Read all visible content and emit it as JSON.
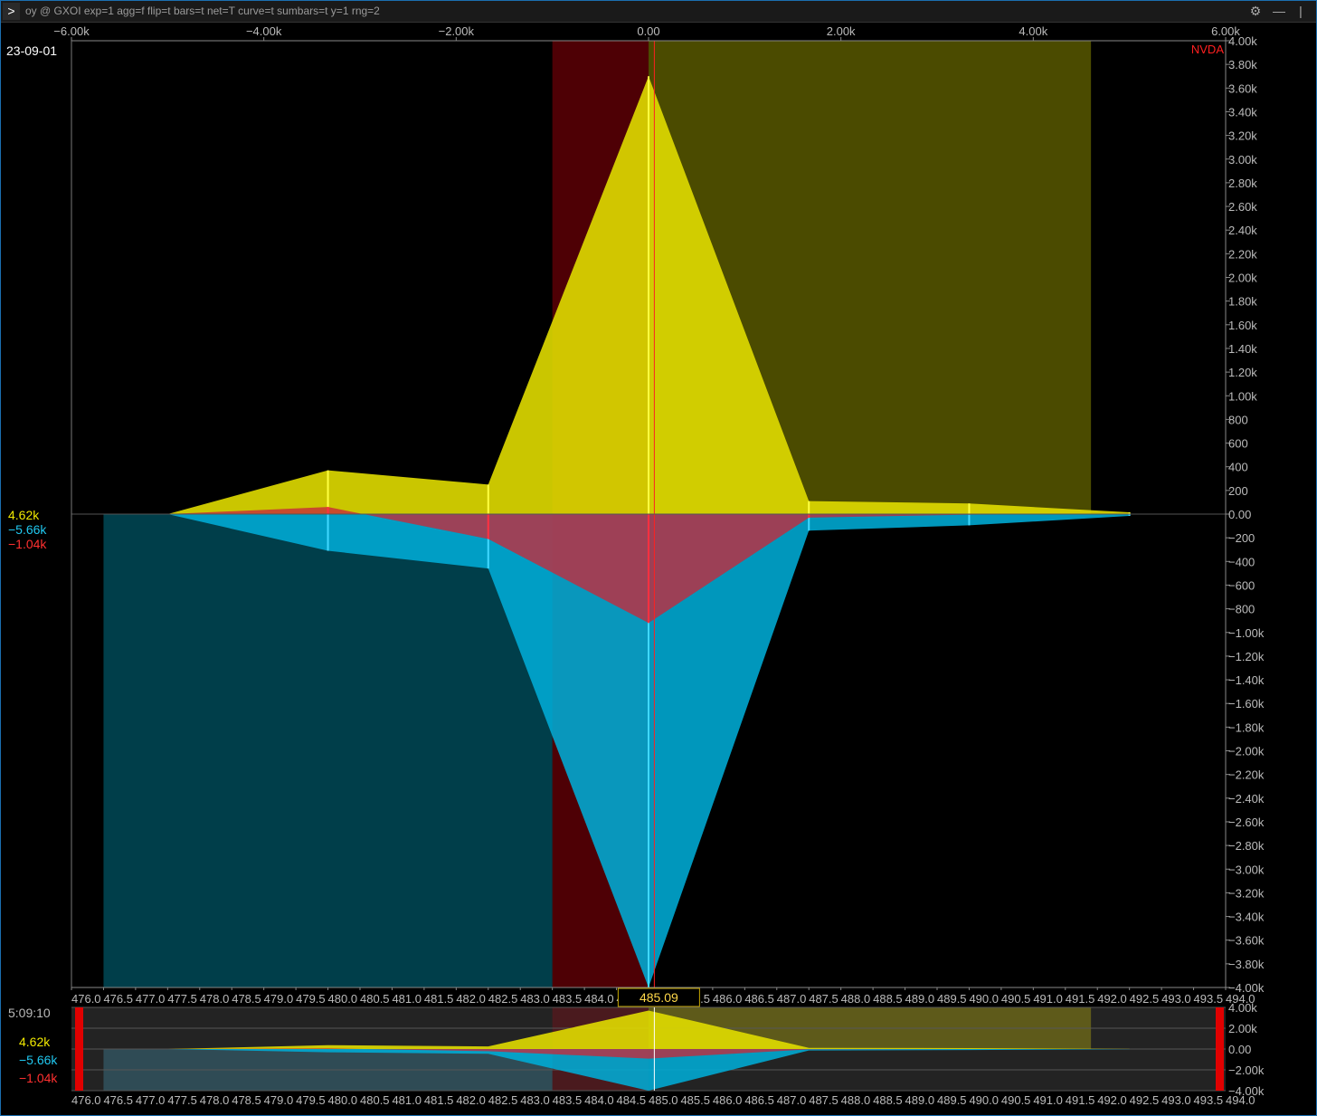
{
  "toolbar": {
    "prompt_glyph": ">",
    "command": "oy @ GXOI exp=1 agg=f flip=t bars=t net=T curve=t sumbars=t y=1 rng=2",
    "settings_icon": "gear-icon",
    "minimize_glyph": "—",
    "close_glyph": "|"
  },
  "header": {
    "date": "23-09-01",
    "ticker": "NVDA"
  },
  "legend": {
    "pos_value": "4.62k",
    "neg_value": "−5.66k",
    "net_value": "−1.04k"
  },
  "overview": {
    "time": "5:09:10",
    "pos_value": "4.62k",
    "neg_value": "−5.66k",
    "net_value": "−1.04k"
  },
  "colors": {
    "pos": "#e0dc00",
    "neg": "#00acd6",
    "net": "#c8283a",
    "pos_bar": "#4b4b00",
    "neg_bar": "#003e4a",
    "spot_band": "#4e0005",
    "cursor_label": "#ffd84a"
  },
  "chart_data": {
    "type": "area",
    "top_axis": {
      "ticks": [
        -6000,
        -4000,
        -2000,
        0,
        2000,
        4000,
        6000
      ],
      "labels": [
        "−6.00k",
        "−4.00k",
        "−2.00k",
        "0.00",
        "2.00k",
        "4.00k",
        "6.00k"
      ],
      "range": [
        -6000,
        6000
      ]
    },
    "y_axis": {
      "range": [
        -4000,
        4000
      ],
      "ticks": [
        4000,
        3800,
        3600,
        3400,
        3200,
        3000,
        2800,
        2600,
        2400,
        2200,
        2000,
        1800,
        1600,
        1400,
        1200,
        1000,
        800,
        600,
        400,
        200,
        0,
        -200,
        -400,
        -600,
        -800,
        -1000,
        -1200,
        -1400,
        -1600,
        -1800,
        -2000,
        -2200,
        -2400,
        -2600,
        -2800,
        -3000,
        -3200,
        -3400,
        -3600,
        -3800,
        -4000
      ],
      "labels": [
        "4.00k",
        "3.80k",
        "3.60k",
        "3.40k",
        "3.20k",
        "3.00k",
        "2.80k",
        "2.60k",
        "2.40k",
        "2.20k",
        "2.00k",
        "1.80k",
        "1.60k",
        "1.40k",
        "1.20k",
        "1.00k",
        "800",
        "600",
        "400",
        "200",
        "0.00",
        "−200",
        "−400",
        "−600",
        "−800",
        "−1.00k",
        "−1.20k",
        "−1.40k",
        "−1.60k",
        "−1.80k",
        "−2.00k",
        "−2.20k",
        "−2.40k",
        "−2.60k",
        "−2.80k",
        "−3.00k",
        "−3.20k",
        "−3.40k",
        "−3.60k",
        "−3.80k",
        "−4.00k"
      ]
    },
    "x_axis": {
      "range": [
        476.0,
        494.0
      ],
      "labels": [
        "476.0",
        "476.5",
        "477.0",
        "477.5",
        "478.0",
        "478.5",
        "479.0",
        "479.5",
        "480.0",
        "480.5",
        "481.0",
        "481.5",
        "482.0",
        "482.5",
        "483.0",
        "483.5",
        "484.0",
        "484.5",
        "485.0",
        "485.5",
        "486.0",
        "486.5",
        "487.0",
        "487.5",
        "488.0",
        "488.5",
        "489.0",
        "489.5",
        "490.0",
        "490.5",
        "491.0",
        "491.5",
        "492.0",
        "492.5",
        "493.0",
        "493.5",
        "494.0"
      ]
    },
    "strikes": [
      477.5,
      480.0,
      482.5,
      485.0,
      487.5,
      490.0,
      492.5
    ],
    "series": [
      {
        "name": "positive",
        "values": [
          0,
          370,
          250,
          3700,
          110,
          90,
          15
        ]
      },
      {
        "name": "negative",
        "values": [
          0,
          -310,
          -460,
          -4000,
          -140,
          -95,
          -15
        ]
      },
      {
        "name": "net",
        "values": [
          0,
          60,
          -210,
          -920,
          -30,
          -5,
          0
        ]
      }
    ],
    "sum_bars": {
      "positive": {
        "x_range": [
          485.0,
          491.9
        ],
        "value": 4620
      },
      "negative": {
        "x_range": [
          476.5,
          485.0
        ],
        "value": -5660
      },
      "net": {
        "x_range": [
          483.5,
          485.0
        ],
        "value": -1040
      }
    },
    "spot_band": [
      483.5,
      485.0
    ],
    "cursor": {
      "x": 485.09,
      "label": "485.09"
    },
    "overview": {
      "y_range": [
        -4000,
        4000
      ],
      "y_labels": [
        "4.00k",
        "2.00k",
        "0.00",
        "−2.00k",
        "−4.00k"
      ]
    }
  }
}
